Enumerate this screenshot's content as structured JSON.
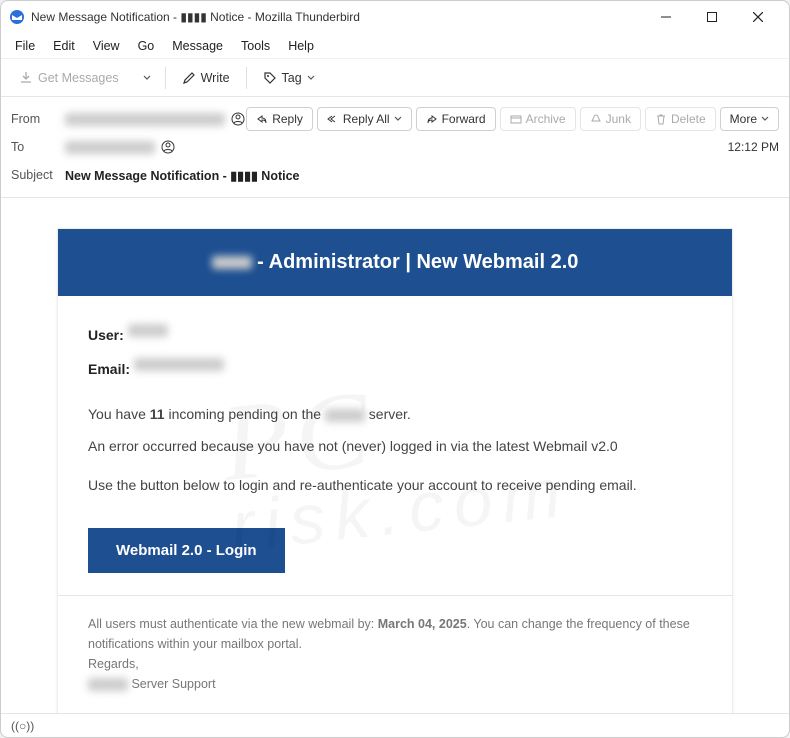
{
  "window": {
    "title": "New Message Notification - ▮▮▮▮ Notice - Mozilla Thunderbird"
  },
  "menus": [
    "File",
    "Edit",
    "View",
    "Go",
    "Message",
    "Tools",
    "Help"
  ],
  "toolbar": {
    "get_messages": "Get Messages",
    "write": "Write",
    "tag": "Tag"
  },
  "headers": {
    "from_label": "From",
    "to_label": "To",
    "subject_label": "Subject",
    "subject_value": "New Message Notification - ▮▮▮▮ Notice",
    "time": "12:12 PM"
  },
  "actions": {
    "reply": "Reply",
    "reply_all": "Reply All",
    "forward": "Forward",
    "archive": "Archive",
    "junk": "Junk",
    "delete": "Delete",
    "more": "More"
  },
  "email": {
    "banner_prefix": "▮▮▮▮",
    "banner_suffix": " - Administrator | New Webmail 2.0",
    "user_label": "User:",
    "email_label": "Email:",
    "line1a": "You have ",
    "count": "11",
    "line1b": " incoming pending on the ",
    "line1c": " server.",
    "line2": "An error occurred because you have not (never) logged in via the latest Webmail v2.0",
    "line3": "Use the button below to login and re-authenticate your account to receive pending email.",
    "login_btn": "Webmail 2.0 - Login",
    "foot1a": "All users must authenticate via the new webmail by: ",
    "deadline": "March 04, 2025",
    "foot1b": ". You can change the frequency of these notifications within your mailbox portal.",
    "foot2": "Regards,",
    "foot3": " Server Support"
  },
  "status": {
    "indicator": "((○))"
  }
}
